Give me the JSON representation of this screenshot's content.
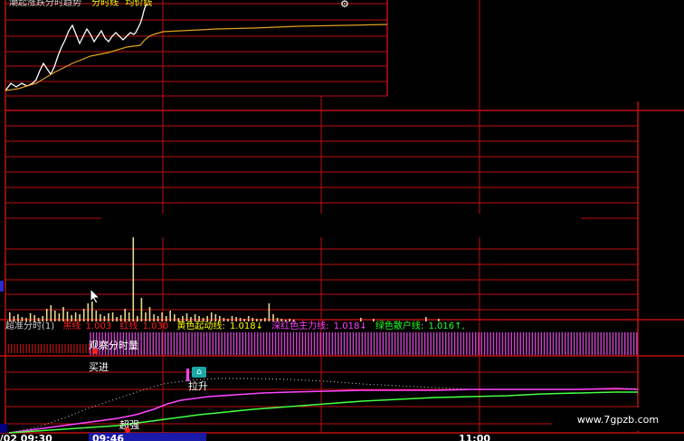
{
  "title_strip": {
    "chart_name": "潮起涨跌分时趋势",
    "legend_a": "分时线",
    "legend_b": "均价线"
  },
  "main_panel": {
    "price_line_color": "#ffffff",
    "avg_line_color": "#e0a020"
  },
  "volume_panel": {
    "bar_color": "#e8d890"
  },
  "info_bar": {
    "indicator_name": "超准分时(1)",
    "red_line_label": "黑线",
    "red_line_value": "1.003",
    "red_line2_label": "红线",
    "red_line2_value": "1.030",
    "yellow_label": "黄色起动线:",
    "yellow_value": "1.018↓",
    "magenta_label": "深红色主力线:",
    "magenta_value": "1.018↓",
    "green_label": "绿色散户线:",
    "green_value": "1.016↑,"
  },
  "lower_panel": {
    "observe_label": "观察分时量",
    "buy_label": "买进",
    "pull_label": "拉升",
    "strong_label": "超强",
    "magenta_color": "#ff44ff",
    "green_color": "#44ff44"
  },
  "time_axis": {
    "start": "2/02 09:30",
    "cursor": "09:46",
    "mid": "11:00"
  },
  "watermark": "www.7gpzb.com",
  "icons": {
    "cursor": "mouse-pointer-icon",
    "gear": "gear-icon",
    "house": "house-icon"
  },
  "colors": {
    "grid_red": "#c01010",
    "background": "#000000",
    "info_red": "#ff2020",
    "info_yellow": "#ffff00",
    "info_magenta": "#ff44ff",
    "info_green": "#22ff22"
  }
}
